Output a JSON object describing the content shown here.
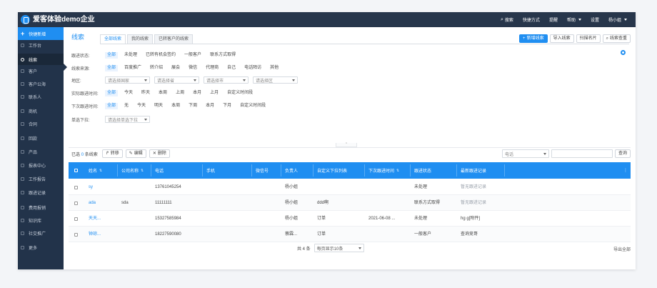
{
  "app": {
    "name": "爱客体验demo企业"
  },
  "topbar": {
    "items": [
      {
        "label": "搜索",
        "icon": "search-icon",
        "dropdown": false
      },
      {
        "label": "快捷方式",
        "dropdown": false
      },
      {
        "label": "提醒",
        "dropdown": false
      },
      {
        "label": "帮助",
        "dropdown": true
      },
      {
        "label": "设置",
        "dropdown": false
      },
      {
        "label": "杨小姐",
        "dropdown": true
      }
    ]
  },
  "sidebar": {
    "quick_create": "快捷新增",
    "items": [
      {
        "label": "工作台",
        "icon": "dashboard-icon",
        "active": false
      },
      {
        "label": "线索",
        "icon": "lead-icon",
        "active": true
      },
      {
        "label": "客户",
        "icon": "customer-icon",
        "active": false
      },
      {
        "label": "客户公海",
        "icon": "pool-icon",
        "active": false
      },
      {
        "label": "联系人",
        "icon": "contact-icon",
        "active": false
      },
      {
        "label": "商机",
        "icon": "opportunity-icon",
        "active": false
      },
      {
        "label": "合同",
        "icon": "contract-icon",
        "active": false
      },
      {
        "label": "回款",
        "icon": "payment-icon",
        "active": false
      },
      {
        "label": "产品",
        "icon": "product-icon",
        "active": false
      },
      {
        "label": "报表中心",
        "icon": "report-icon",
        "active": false
      },
      {
        "label": "工作报告",
        "icon": "work-report-icon",
        "active": false
      },
      {
        "label": "跟进记录",
        "icon": "followup-icon",
        "active": false
      },
      {
        "label": "费用报销",
        "icon": "expense-icon",
        "active": false
      },
      {
        "label": "知识库",
        "icon": "knowledge-icon",
        "active": false
      },
      {
        "label": "社交推广",
        "icon": "social-icon",
        "active": false
      },
      {
        "label": "更多",
        "icon": "more-icon",
        "active": false
      }
    ]
  },
  "page": {
    "title": "线索",
    "tabs": [
      {
        "label": "全部线索",
        "active": true
      },
      {
        "label": "我的线索",
        "active": false
      },
      {
        "label": "已转客户的线索",
        "active": false
      }
    ],
    "actions": [
      {
        "label": "新增线索",
        "primary": true,
        "prefix": "+"
      },
      {
        "label": "导入线索",
        "primary": false,
        "prefix": ""
      },
      {
        "label": "扫描名片",
        "primary": false,
        "prefix": ""
      },
      {
        "label": "线索查重",
        "primary": false,
        "prefix": "search"
      }
    ]
  },
  "filters": {
    "status": {
      "label": "跟进状态:",
      "options": [
        "全部",
        "未处理",
        "已转有机会签约",
        "一般客户",
        "联系方式取得"
      ]
    },
    "source": {
      "label": "线索来源:",
      "options": [
        "全部",
        "百度推广",
        "转介绍",
        "展会",
        "微信",
        "代理商",
        "自己",
        "电话陌访",
        "其他"
      ]
    },
    "region": {
      "label": "地区:",
      "selects": [
        "请选择国家",
        "请选择省",
        "请选择市",
        "请选择区"
      ]
    },
    "last_follow": {
      "label": "实际跟进时间:",
      "options": [
        "全部",
        "今天",
        "昨天",
        "本周",
        "上周",
        "本月",
        "上月",
        "自定义时间段"
      ]
    },
    "next_follow": {
      "label": "下次跟进时间:",
      "options": [
        "全部",
        "无",
        "今天",
        "明天",
        "本周",
        "下周",
        "本月",
        "下月",
        "自定义时间段"
      ]
    },
    "custom_dropdown": {
      "label": "单选下拉:",
      "placeholder": "请选择单选下拉"
    }
  },
  "toolbar": {
    "selected_prefix": "已选",
    "selected_count": "0",
    "selected_suffix": "条线索",
    "transfer": "转移",
    "edit": "编辑",
    "delete": "删除",
    "search_field": "电话",
    "search_button": "查询"
  },
  "table": {
    "columns": [
      "姓名",
      "公司名称",
      "电话",
      "手机",
      "微信号",
      "负责人",
      "自定义下拉列表",
      "下次跟进时间",
      "跟进状态",
      "最新跟进记录"
    ],
    "rows": [
      [
        "sy",
        "",
        "13761045254",
        "",
        "",
        "杨小姐",
        "",
        "",
        "未处理",
        "暂无跟进记录"
      ],
      [
        "ada",
        "sda",
        "11111111",
        "",
        "",
        "杨小姐",
        "ddd啊",
        "",
        "联系方式取得",
        "暂无跟进记录"
      ],
      [
        "天天...",
        "",
        "15327585984",
        "",
        "",
        "杨小姐",
        "订单",
        "2021-06-08 ...",
        "未处理",
        "hg g[附件]"
      ],
      [
        "钟琼...",
        "",
        "18227590080",
        "",
        "",
        "蔡霖...",
        "订单",
        "",
        "一般客户",
        "查询竞哥"
      ]
    ]
  },
  "pagination": {
    "total": "共 4 条",
    "per_page": "每页显示10条",
    "export": "导出全部"
  }
}
